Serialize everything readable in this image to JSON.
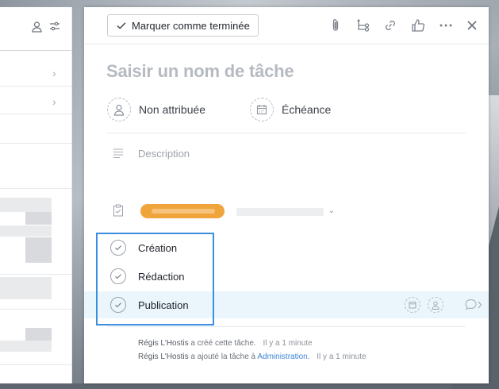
{
  "toolbar": {
    "mark_complete_label": "Marquer comme terminée"
  },
  "task": {
    "title_placeholder": "Saisir un nom de tâche",
    "assignee_label": "Non attribuée",
    "due_label": "Échéance",
    "description_placeholder": "Description"
  },
  "subtasks": [
    {
      "name": "Création"
    },
    {
      "name": "Rédaction"
    },
    {
      "name": "Publication"
    }
  ],
  "activity": [
    {
      "who": "Régis L'Hostis",
      "text": "a créé cette tâche.",
      "link": "",
      "after": "",
      "time": "Il y a 1 minute"
    },
    {
      "who": "Régis L'Hostis",
      "text": "a ajouté la tâche à",
      "link": "Administration",
      "after": ".",
      "time": "Il y a 1 minute"
    }
  ],
  "colors": {
    "project_pill": "#f0a53c",
    "selection_border": "#3b8ee0",
    "highlight_row": "#eaf6fb",
    "link": "#3b86d6"
  },
  "icons": {
    "toolbar": [
      "paperclip-icon",
      "subtask-icon",
      "link-icon",
      "like-icon",
      "more-icon",
      "close-icon"
    ]
  }
}
